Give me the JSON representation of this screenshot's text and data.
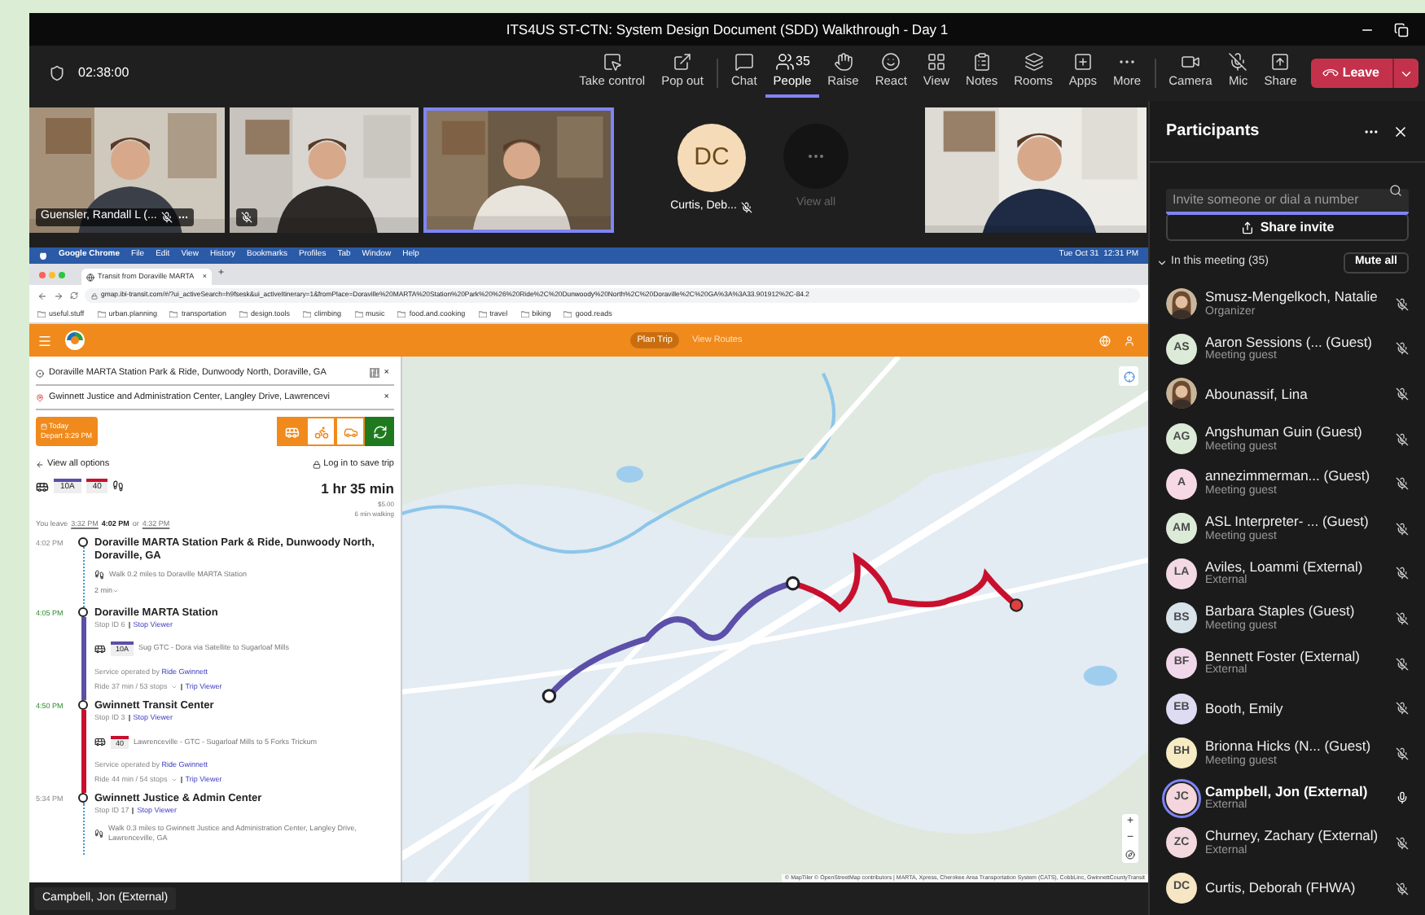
{
  "window": {
    "title": "ITS4US ST-CTN: System Design Document (SDD) Walkthrough - Day 1"
  },
  "toolbar": {
    "timer": "02:38:00",
    "buttons": [
      {
        "kind": "take-control",
        "label": "Take control",
        "selected": false
      },
      {
        "kind": "pop-out",
        "label": "Pop out",
        "selected": false
      },
      {
        "kind": "chat",
        "label": "Chat",
        "selected": false
      },
      {
        "kind": "people",
        "label": "People",
        "count": "35",
        "selected": true
      },
      {
        "kind": "raise",
        "label": "Raise",
        "selected": false
      },
      {
        "kind": "react",
        "label": "React",
        "selected": false
      },
      {
        "kind": "view",
        "label": "View",
        "selected": false
      },
      {
        "kind": "notes",
        "label": "Notes",
        "selected": false
      },
      {
        "kind": "rooms",
        "label": "Rooms",
        "selected": false
      },
      {
        "kind": "apps",
        "label": "Apps",
        "selected": false
      },
      {
        "kind": "more",
        "label": "More",
        "selected": false
      },
      {
        "kind": "camera",
        "label": "Camera",
        "selected": false
      },
      {
        "kind": "mic",
        "label": "Mic",
        "selected": false
      },
      {
        "kind": "share",
        "label": "Share",
        "selected": false
      }
    ],
    "leave": "Leave"
  },
  "video_tiles": [
    {
      "kind": "picture",
      "name": "Guensler, Randall L (...",
      "muted": true,
      "speaking": false
    },
    {
      "kind": "picture",
      "muted": true,
      "speaking": false
    },
    {
      "kind": "picture",
      "muted": false,
      "speaking": true
    },
    {
      "kind": "avatar",
      "initials": "DC",
      "name": "Curtis, Deb...",
      "muted": true
    },
    {
      "kind": "view-all",
      "name": "View all"
    },
    {
      "kind": "picture",
      "muted": false,
      "speaking": false
    }
  ],
  "shared_screen": {
    "menu_bar": [
      "Google Chrome",
      "File",
      "Edit",
      "View",
      "History",
      "Bookmarks",
      "Profiles",
      "Tab",
      "Window",
      "Help"
    ],
    "clock": "Tue Oct 31  12:31 PM",
    "tab": {
      "title": "Transit from Doraville MARTA",
      "close": "×",
      "new_tab": "+"
    },
    "url": "gmap.ibi-transit.com/#/?ui_activeSearch=h9fsesk&ui_activeItinerary=1&fromPlace=Doraville%20MARTA%20Station%20Park%20%26%20Ride%2C%20Dunwoody%20North%2C%20Doraville%2C%20GA%3A%3A33.901912%2C-84.2",
    "bookmarks": [
      "useful.stuff",
      "urban.planning",
      "transportation",
      "design.tools",
      "climbing",
      "music",
      "food.and.cooking",
      "travel",
      "biking",
      "good.reads"
    ],
    "nav": [
      {
        "label": "Plan Trip",
        "selected": true
      },
      {
        "label": "View Routes",
        "selected": false
      }
    ],
    "from": "Doraville MARTA Station Park & Ride, Dunwoody North, Doraville, GA",
    "to": "Gwinnett Justice and Administration Center, Langley Drive, Lawrencevi",
    "clear": "×",
    "date": {
      "day": "Today",
      "depart": "Depart 3:29 PM"
    },
    "modes": [
      {
        "kind": "transit",
        "selected": true
      },
      {
        "kind": "bike",
        "selected": false
      },
      {
        "kind": "car",
        "selected": false
      }
    ],
    "view_all": "View all options",
    "login": "Log in to save trip",
    "routes": [
      {
        "label": "10A",
        "color": "#5b4fa8"
      },
      {
        "label": "40",
        "color": "#c8102e"
      }
    ],
    "duration": "1 hr 35 min",
    "fare": "$5.00",
    "walking": "6 min walking",
    "leave": {
      "prefix": "You leave",
      "options": [
        {
          "time": "3:32 PM",
          "selected": false
        },
        {
          "time": "4:02 PM",
          "selected": true
        },
        {
          "time": "4:32 PM",
          "selected": false
        }
      ],
      "or": "or"
    },
    "steps": [
      {
        "time": "4:02 PM",
        "live": false,
        "title": "Doraville MARTA Station Park & Ride, Dunwoody North, Doraville, GA",
        "leg": {
          "kind": "walk",
          "text": "Walk 0.2 miles to Doraville MARTA Station",
          "duration": "2 min"
        }
      },
      {
        "time": "4:05 PM",
        "live": true,
        "title": "Doraville MARTA Station",
        "stop_id": "Stop ID 6",
        "stop_link": "Stop Viewer",
        "leg": {
          "kind": "bus",
          "route": "10A",
          "color": "#5b4fa8",
          "text": "Sug GTC - Dora via Satellite to Sugarloaf Mills",
          "operator": "Service operated by",
          "agency": "Ride Gwinnett",
          "ride": "Ride 37 min / 53 stops",
          "trip": "Trip Viewer"
        }
      },
      {
        "time": "4:50 PM",
        "live": true,
        "title": "Gwinnett Transit Center",
        "stop_id": "Stop ID 3",
        "stop_link": "Stop Viewer",
        "leg": {
          "kind": "bus",
          "route": "40",
          "color": "#c8102e",
          "text": "Lawrenceville - GTC - Sugarloaf Mills to 5 Forks Trickum",
          "operator": "Service operated by",
          "agency": "Ride Gwinnett",
          "ride": "Ride 44 min / 54 stops",
          "trip": "Trip Viewer"
        }
      },
      {
        "time": "5:34 PM",
        "live": false,
        "title": "Gwinnett Justice & Admin Center",
        "stop_id": "Stop ID 17",
        "stop_link": "Stop Viewer",
        "leg": {
          "kind": "walk",
          "text": "Walk 0.3 miles to Gwinnett Justice and Administration Center, Langley Drive, Lawrenceville, GA"
        }
      }
    ],
    "map": {
      "kind": "picture",
      "zoom_in": "+",
      "zoom_out": "−",
      "attribution": "© MapTiler © OpenStreetMap contributors | MARTA, Xpress, Cherokee Area Transportation System (CATS), CobbLinc, GwinnettCountyTransit"
    }
  },
  "caption": "Campbell, Jon (External)",
  "participants": {
    "title": "Participants",
    "search": {
      "placeholder": "Invite someone or dial a number"
    },
    "share_invite": "Share invite",
    "section": {
      "label": "In this meeting (35)",
      "expanded": true
    },
    "mute_all": "Mute all",
    "people": [
      {
        "name": "Smusz-Mengelkoch, Natalie",
        "role": "Organizer",
        "muted": true,
        "speaking": false
      },
      {
        "kind": "initials",
        "initials": "AS",
        "color": "#dcebd8",
        "name": "Aaron Sessions (... (Guest)",
        "role": "Meeting guest",
        "muted": true,
        "speaking": false
      },
      {
        "name": "Abounassif, Lina",
        "muted": true,
        "speaking": false
      },
      {
        "kind": "initials",
        "initials": "AG",
        "color": "#dcebd8",
        "name": "Angshuman Guin (Guest)",
        "role": "Meeting guest",
        "muted": true,
        "speaking": false
      },
      {
        "kind": "initials",
        "initials": "A",
        "color": "#f7d9e6",
        "name": "annezimmerman... (Guest)",
        "role": "Meeting guest",
        "muted": true,
        "speaking": false
      },
      {
        "kind": "initials",
        "initials": "AM",
        "color": "#dcebd8",
        "name": "ASL Interpreter- ... (Guest)",
        "role": "Meeting guest",
        "muted": true,
        "speaking": false
      },
      {
        "kind": "initials",
        "initials": "LA",
        "color": "#f3d9e3",
        "name": "Aviles, Loammi (External)",
        "role": "External",
        "muted": true,
        "speaking": false
      },
      {
        "kind": "initials",
        "initials": "BS",
        "color": "#d9e4ea",
        "name": "Barbara Staples (Guest)",
        "role": "Meeting guest",
        "muted": true,
        "speaking": false
      },
      {
        "kind": "initials",
        "initials": "BF",
        "color": "#f0d8ea",
        "name": "Bennett Foster (External)",
        "role": "External",
        "muted": true,
        "speaking": false
      },
      {
        "kind": "initials",
        "initials": "EB",
        "color": "#dedcf2",
        "name": "Booth, Emily",
        "muted": true,
        "speaking": false
      },
      {
        "kind": "initials",
        "initials": "BH",
        "color": "#f7ebc4",
        "name": "Brionna Hicks (N... (Guest)",
        "role": "Meeting guest",
        "muted": true,
        "speaking": false
      },
      {
        "kind": "initials",
        "initials": "JC",
        "color": "#f5d6dc",
        "name": "Campbell, Jon (External)",
        "role": "External",
        "muted": false,
        "speaking": true
      },
      {
        "kind": "initials",
        "initials": "ZC",
        "color": "#f3d9de",
        "name": "Churney, Zachary (External)",
        "role": "External",
        "muted": true,
        "speaking": false
      },
      {
        "kind": "initials",
        "initials": "DC",
        "color": "#f7e6c4",
        "name": "Curtis, Deborah (FHWA)",
        "muted": true,
        "speaking": false
      }
    ]
  }
}
